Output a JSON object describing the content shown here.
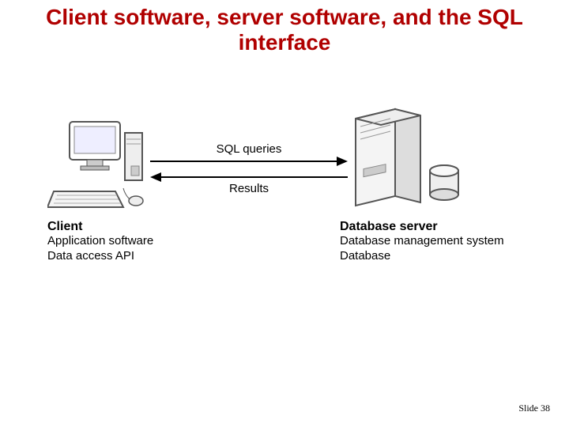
{
  "title": "Client software, server software, and the SQL interface",
  "diagram": {
    "client": {
      "heading": "Client",
      "line1": "Application software",
      "line2": "Data access API",
      "icon_name": "client-computer-icon"
    },
    "server": {
      "heading": "Database server",
      "line1": "Database management system",
      "line2": "Database",
      "icon_name": "server-tower-icon"
    },
    "arrows": {
      "to_server_label": "SQL queries",
      "to_client_label": "Results"
    }
  },
  "footer": "Slide 38"
}
